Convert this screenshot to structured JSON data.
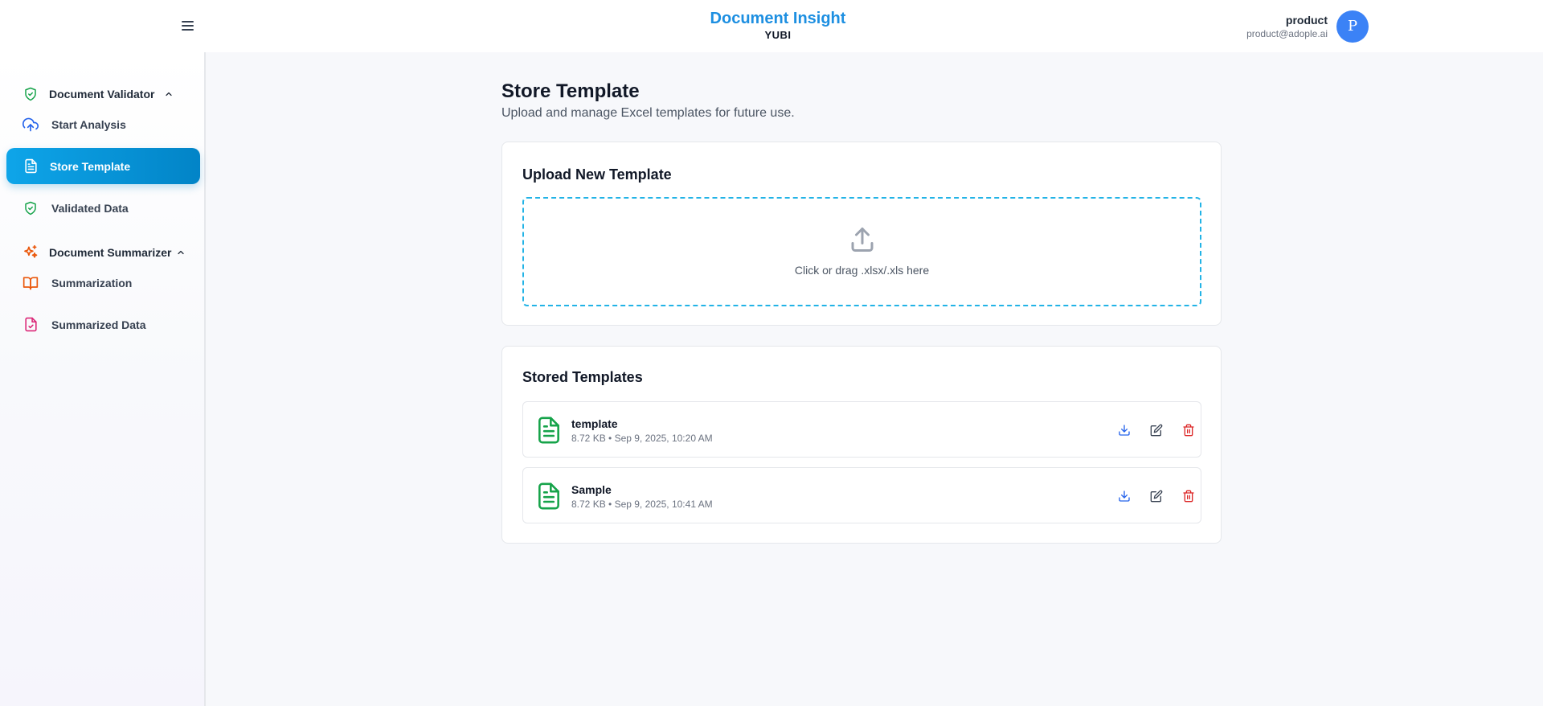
{
  "header": {
    "app_title": "Document Insight",
    "app_subtitle": "YUBI",
    "user_name": "product",
    "user_email": "product@adople.ai",
    "avatar_initial": "P"
  },
  "sidebar": {
    "sections": [
      {
        "label": "Document Validator",
        "icon": "shield-check-icon",
        "expanded": true,
        "items": [
          {
            "label": "Start Analysis",
            "icon": "cloud-upload-icon",
            "active": false
          },
          {
            "label": "Store Template",
            "icon": "file-text-icon",
            "active": true
          },
          {
            "label": "Validated Data",
            "icon": "shield-check-icon",
            "active": false
          }
        ]
      },
      {
        "label": "Document Summarizer",
        "icon": "sparkles-icon",
        "expanded": true,
        "items": [
          {
            "label": "Summarization",
            "icon": "book-open-icon",
            "active": false
          },
          {
            "label": "Summarized Data",
            "icon": "file-check-icon",
            "active": false
          }
        ]
      }
    ]
  },
  "main": {
    "title": "Store Template",
    "subtitle": "Upload and manage Excel templates for future use.",
    "upload": {
      "title": "Upload New Template",
      "dropzone_text": "Click or drag .xlsx/.xls here"
    },
    "stored": {
      "title": "Stored Templates",
      "items": [
        {
          "name": "template",
          "meta": "8.72 KB • Sep 9, 2025, 10:20 AM"
        },
        {
          "name": "Sample",
          "meta": "8.72 KB • Sep 9, 2025, 10:41 AM"
        }
      ]
    }
  },
  "colors": {
    "brand": "#1d8fe1",
    "active_nav": "#0ea5e9",
    "dropzone_border": "#22b3e6",
    "file_icon": "#16a34a",
    "download": "#2563eb",
    "delete": "#dc2626",
    "avatar": "#3b82f6"
  }
}
